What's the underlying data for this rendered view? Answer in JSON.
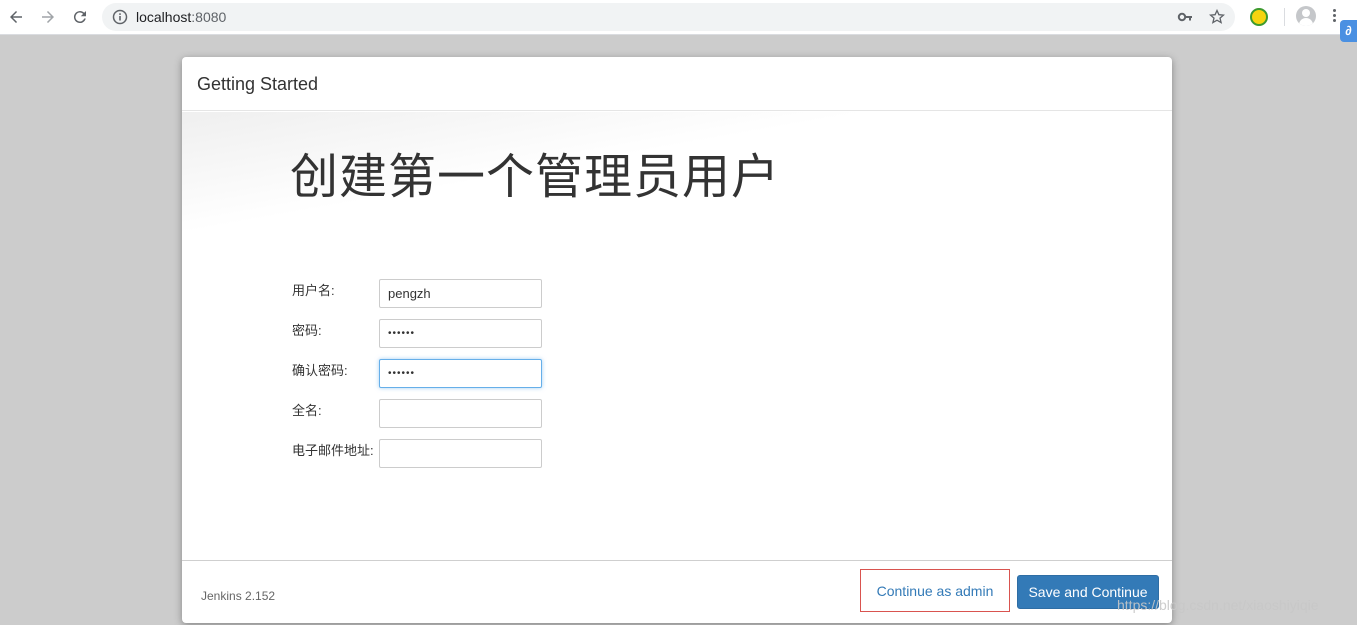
{
  "browser": {
    "url_host": "localhost",
    "url_port": ":8080"
  },
  "dialog": {
    "title": "Getting Started",
    "heading": "创建第一个管理员用户",
    "fields": [
      {
        "label": "用户名:",
        "value": "pengzh",
        "type": "text"
      },
      {
        "label": "密码:",
        "value": "••••••",
        "type": "password"
      },
      {
        "label": "确认密码:",
        "value": "••••••",
        "type": "password"
      },
      {
        "label": "全名:",
        "value": "",
        "type": "text"
      },
      {
        "label": "电子邮件地址:",
        "value": "",
        "type": "text"
      }
    ],
    "footer": {
      "version": "Jenkins 2.152",
      "continue_as_admin": "Continue as admin",
      "save_and_continue": "Save and Continue"
    }
  },
  "watermark": "https://blog.csdn.net/xiaoshiyiqie",
  "colors": {
    "primary": "#337ab7",
    "highlight_border": "#d9534f",
    "page_background": "#cccccc"
  }
}
